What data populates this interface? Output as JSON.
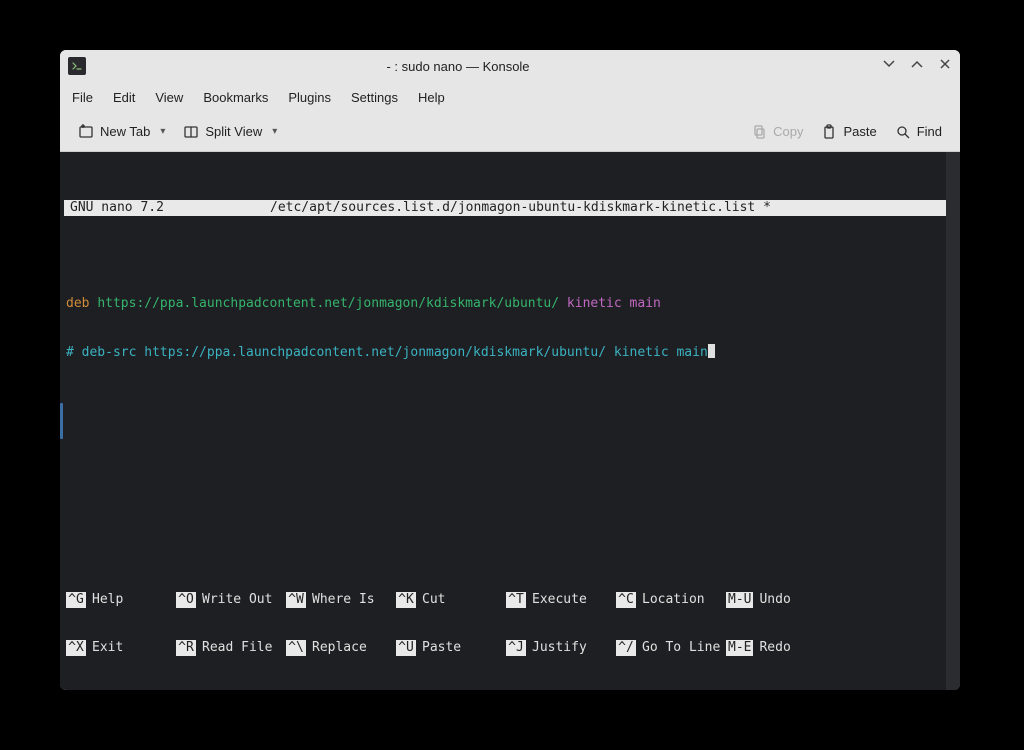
{
  "window": {
    "title": "- : sudo nano — Konsole"
  },
  "menubar": [
    "File",
    "Edit",
    "View",
    "Bookmarks",
    "Plugins",
    "Settings",
    "Help"
  ],
  "toolbar": {
    "newtab": "New Tab",
    "splitview": "Split View",
    "copy": "Copy",
    "paste": "Paste",
    "find": "Find"
  },
  "nano": {
    "version": "GNU nano 7.2",
    "filename": "/etc/apt/sources.list.d/jonmagon-ubuntu-kdiskmark-kinetic.list *",
    "line1": {
      "keyword": "deb",
      "url": "https://ppa.launchpadcontent.net/jonmagon/kdiskmark/ubuntu/",
      "suite": "kinetic main"
    },
    "line2": {
      "full": "# deb-src https://ppa.launchpadcontent.net/jonmagon/kdiskmark/ubuntu/ kinetic main"
    },
    "shortcuts": {
      "row1": [
        {
          "key": "^G",
          "label": "Help"
        },
        {
          "key": "^O",
          "label": "Write Out"
        },
        {
          "key": "^W",
          "label": "Where Is"
        },
        {
          "key": "^K",
          "label": "Cut"
        },
        {
          "key": "^T",
          "label": "Execute"
        },
        {
          "key": "^C",
          "label": "Location"
        },
        {
          "key": "M-U",
          "label": "Undo"
        },
        {
          "key": "",
          "label": ""
        }
      ],
      "row2": [
        {
          "key": "^X",
          "label": "Exit"
        },
        {
          "key": "^R",
          "label": "Read File"
        },
        {
          "key": "^\\",
          "label": "Replace"
        },
        {
          "key": "^U",
          "label": "Paste"
        },
        {
          "key": "^J",
          "label": "Justify"
        },
        {
          "key": "^/",
          "label": "Go To Line"
        },
        {
          "key": "M-E",
          "label": "Redo"
        },
        {
          "key": "",
          "label": ""
        }
      ]
    }
  }
}
